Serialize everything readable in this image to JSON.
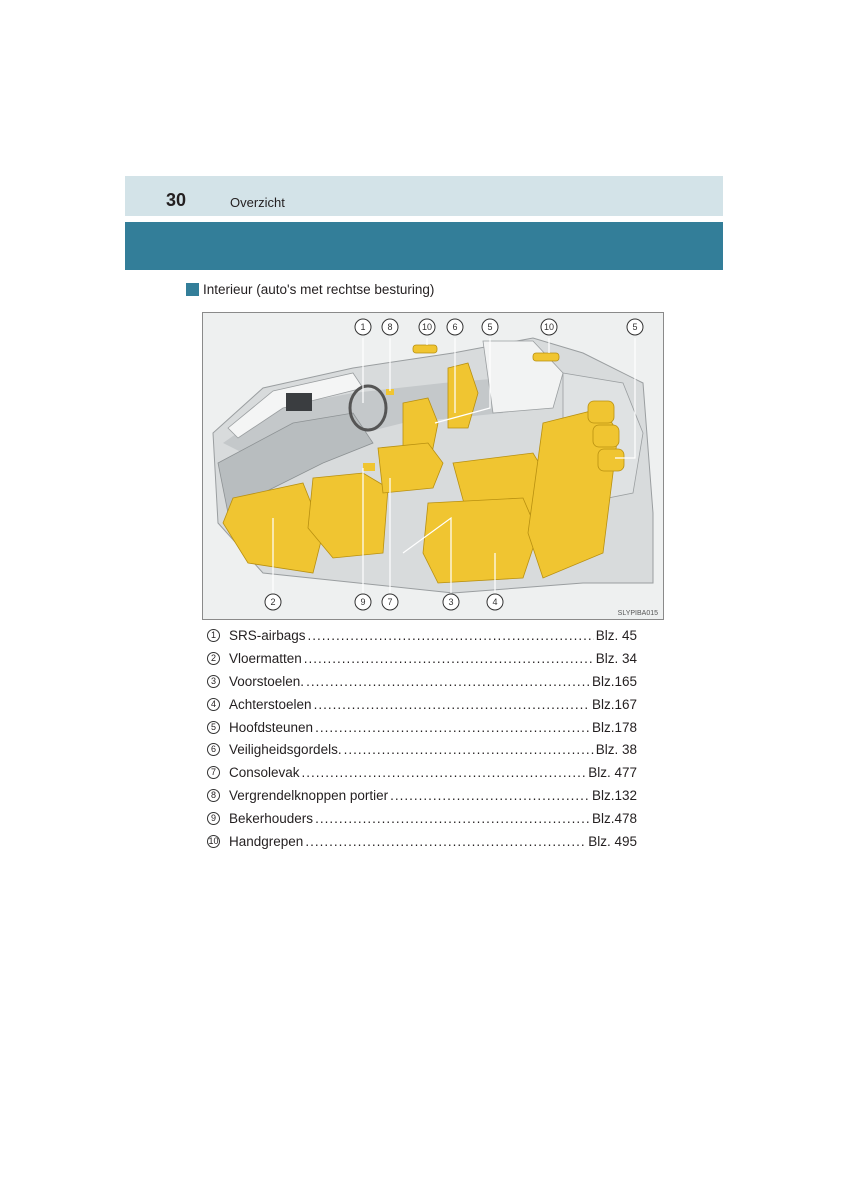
{
  "header": {
    "page_number": "30",
    "chapter_title": "Overzicht"
  },
  "subsection_title": "Interieur (auto's met rechtse besturing)",
  "figure": {
    "code": "SLYPIBA015",
    "callouts": [
      "1",
      "8",
      "10",
      "6",
      "5",
      "10",
      "5",
      "2",
      "9",
      "7",
      "3",
      "4"
    ]
  },
  "items": [
    {
      "num": "1",
      "label": "SRS-airbags",
      "page": "Blz. 45"
    },
    {
      "num": "2",
      "label": "Vloermatten",
      "page": "Blz. 34"
    },
    {
      "num": "3",
      "label": "Voorstoelen.",
      "page": "Blz.165"
    },
    {
      "num": "4",
      "label": "Achterstoelen",
      "page": "Blz.167"
    },
    {
      "num": "5",
      "label": "Hoofdsteunen",
      "page": "Blz.178"
    },
    {
      "num": "6",
      "label": "Veiligheidsgordels.",
      "page": "Blz. 38"
    },
    {
      "num": "7",
      "label": "Consolevak",
      "page": "Blz. 477"
    },
    {
      "num": "8",
      "label": "Vergrendelknoppen portier",
      "page": "Blz.132"
    },
    {
      "num": "9",
      "label": "Bekerhouders",
      "page": "Blz.478"
    },
    {
      "num": "10",
      "label": "Handgrepen",
      "page": "Blz. 495"
    }
  ],
  "colors": {
    "header_band": "#d3e3e8",
    "section_band": "#337e99",
    "highlight_yellow": "#f0c531"
  }
}
